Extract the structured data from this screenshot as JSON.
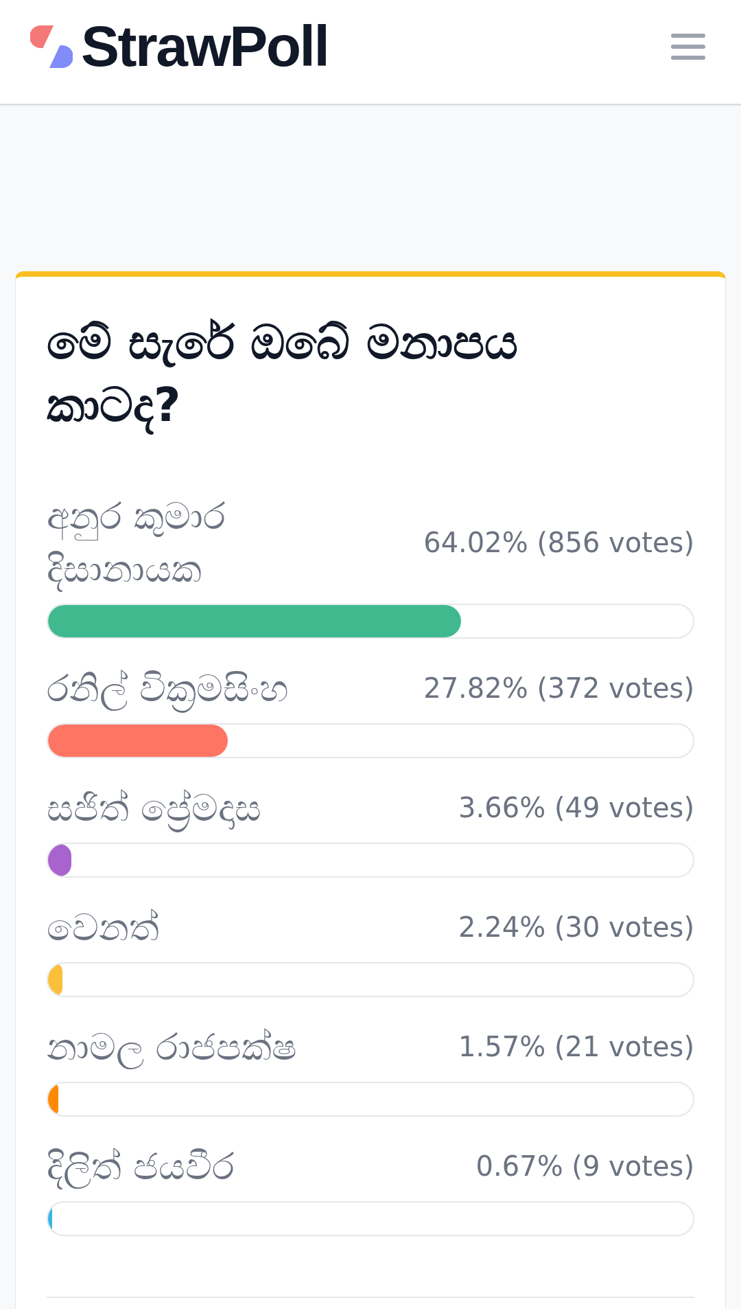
{
  "header": {
    "logo": "StrawPoll"
  },
  "poll": {
    "question": "මේ සැරේ ඔබේ මනාපය කාටද?",
    "options": [
      {
        "label": "අනුර කුමාර දිසානායක",
        "result": "64.02% (856 votes)",
        "level": 0.6402,
        "color": "#40b98f"
      },
      {
        "label": "රනිල් වික්‍රමසිංහ",
        "result": "27.82% (372 votes)",
        "level": 0.2782,
        "color": "#ff7563"
      },
      {
        "label": "සජිත් ප්‍රේමදාස",
        "result": "3.66% (49 votes)",
        "level": 0.0366,
        "color": "#a863ce"
      },
      {
        "label": "වෙනත්",
        "result": "2.24% (30 votes)",
        "level": 0.0224,
        "color": "#fcbf3a"
      },
      {
        "label": "නාමල රාජපක්ෂ",
        "result": "1.57% (21 votes)",
        "level": 0.0157,
        "color": "#ff8a00"
      },
      {
        "label": "දිලිත් ජයවීර",
        "result": "0.67% (9 votes)",
        "level": 0.0067,
        "color": "#38b6e3"
      }
    ]
  }
}
